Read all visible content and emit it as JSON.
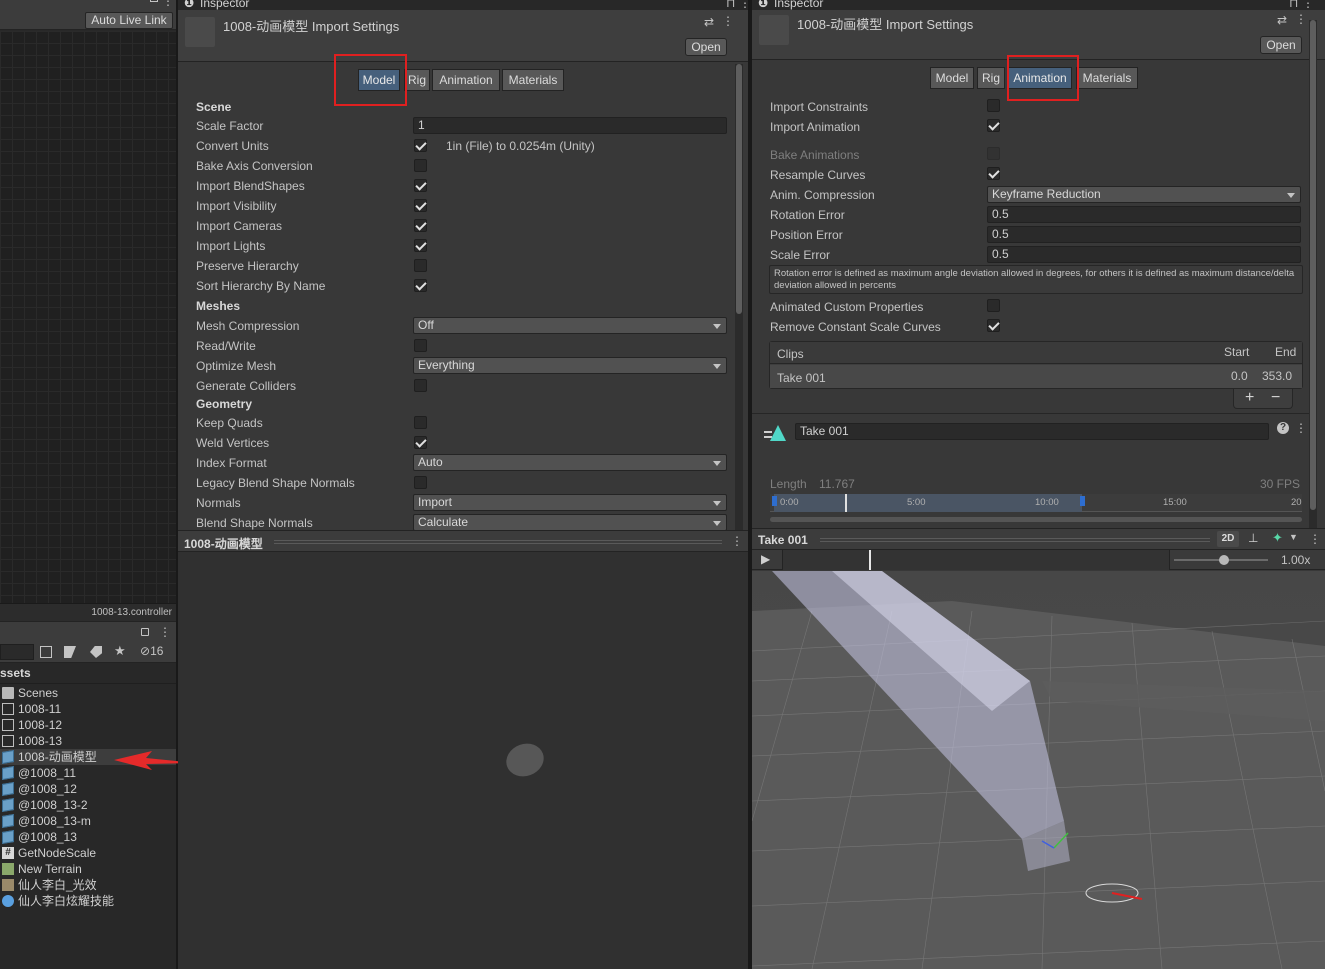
{
  "left_panel": {
    "auto_live_link": "Auto Live Link",
    "controller_label": "1008-13.controller",
    "search_count": "16",
    "assets_header": "ssets",
    "assets": [
      {
        "name": "Scenes",
        "icon": "folder-icon"
      },
      {
        "name": "1008-11",
        "icon": "controller-icon"
      },
      {
        "name": "1008-12",
        "icon": "controller-icon"
      },
      {
        "name": "1008-13",
        "icon": "controller-icon"
      },
      {
        "name": "1008-动画模型",
        "icon": "model-icon"
      },
      {
        "name": "@1008_11",
        "icon": "model-icon"
      },
      {
        "name": "@1008_12",
        "icon": "model-icon"
      },
      {
        "name": "@1008_13-2",
        "icon": "model-icon"
      },
      {
        "name": "@1008_13-m",
        "icon": "model-icon"
      },
      {
        "name": "@1008_13",
        "icon": "model-icon"
      },
      {
        "name": "GetNodeScale",
        "icon": "script-icon"
      },
      {
        "name": "New Terrain",
        "icon": "terrain-icon"
      },
      {
        "name": "仙人李白_光效",
        "icon": "texture-icon"
      },
      {
        "name": "仙人李白炫耀技能",
        "icon": "effect-icon"
      }
    ]
  },
  "inspector1": {
    "tab_title": "Inspector",
    "title": "1008-动画模型 Import Settings",
    "open_label": "Open",
    "tabs": [
      "Model",
      "Rig",
      "Animation",
      "Materials"
    ],
    "selected_tab": "Model",
    "rows": {
      "scene": "Scene",
      "scale_factor": "Scale Factor",
      "scale_factor_value": "1",
      "convert_units": "Convert Units",
      "convert_units_text": "1in (File) to 0.0254m (Unity)",
      "bake_axis": "Bake Axis Conversion",
      "import_blendshapes": "Import BlendShapes",
      "import_visibility": "Import Visibility",
      "import_cameras": "Import Cameras",
      "import_lights": "Import Lights",
      "preserve_hierarchy": "Preserve Hierarchy",
      "sort_hierarchy": "Sort Hierarchy By Name",
      "meshes": "Meshes",
      "mesh_compression": "Mesh Compression",
      "mesh_compression_value": "Off",
      "read_write": "Read/Write",
      "optimize_mesh": "Optimize Mesh",
      "optimize_mesh_value": "Everything",
      "generate_colliders": "Generate Colliders",
      "geometry": "Geometry",
      "keep_quads": "Keep Quads",
      "weld_vertices": "Weld Vertices",
      "index_format": "Index Format",
      "index_format_value": "Auto",
      "legacy_blend": "Legacy Blend Shape Normals",
      "normals": "Normals",
      "normals_value": "Import",
      "blend_shape_normals": "Blend Shape Normals",
      "blend_shape_normals_value": "Calculate"
    },
    "preview_title": "1008-动画模型"
  },
  "inspector2": {
    "tab_title": "Inspector",
    "title": "1008-动画模型 Import Settings",
    "open_label": "Open",
    "tabs": [
      "Model",
      "Rig",
      "Animation",
      "Materials"
    ],
    "selected_tab": "Animation",
    "rows": {
      "import_constraints": "Import Constraints",
      "import_animation": "Import Animation",
      "bake_animations": "Bake Animations",
      "resample_curves": "Resample Curves",
      "anim_compression": "Anim. Compression",
      "anim_compression_value": "Keyframe Reduction",
      "rotation_error": "Rotation Error",
      "rotation_error_value": "0.5",
      "position_error": "Position Error",
      "position_error_value": "0.5",
      "scale_error": "Scale Error",
      "scale_error_value": "0.5",
      "help_text": "Rotation error is defined as maximum angle deviation allowed in degrees, for others it is defined as maximum distance/delta deviation allowed in percents",
      "animated_custom": "Animated Custom Properties",
      "remove_constant_scale": "Remove Constant Scale Curves"
    },
    "clips": {
      "header": "Clips",
      "start": "Start",
      "end": "End",
      "items": [
        {
          "name": "Take 001",
          "start": "0.0",
          "end": "353.0"
        }
      ],
      "add": "+",
      "remove": "−"
    },
    "clip_name": "Take 001",
    "length_label": "Length",
    "length_value": "11.767",
    "fps": "30 FPS",
    "timeline_ticks": [
      "0:00",
      "5:00",
      "10:00",
      "15:00",
      "20"
    ],
    "preview": {
      "title": "Take 001",
      "mode_2d": "2D",
      "speed": "1.00x"
    }
  }
}
